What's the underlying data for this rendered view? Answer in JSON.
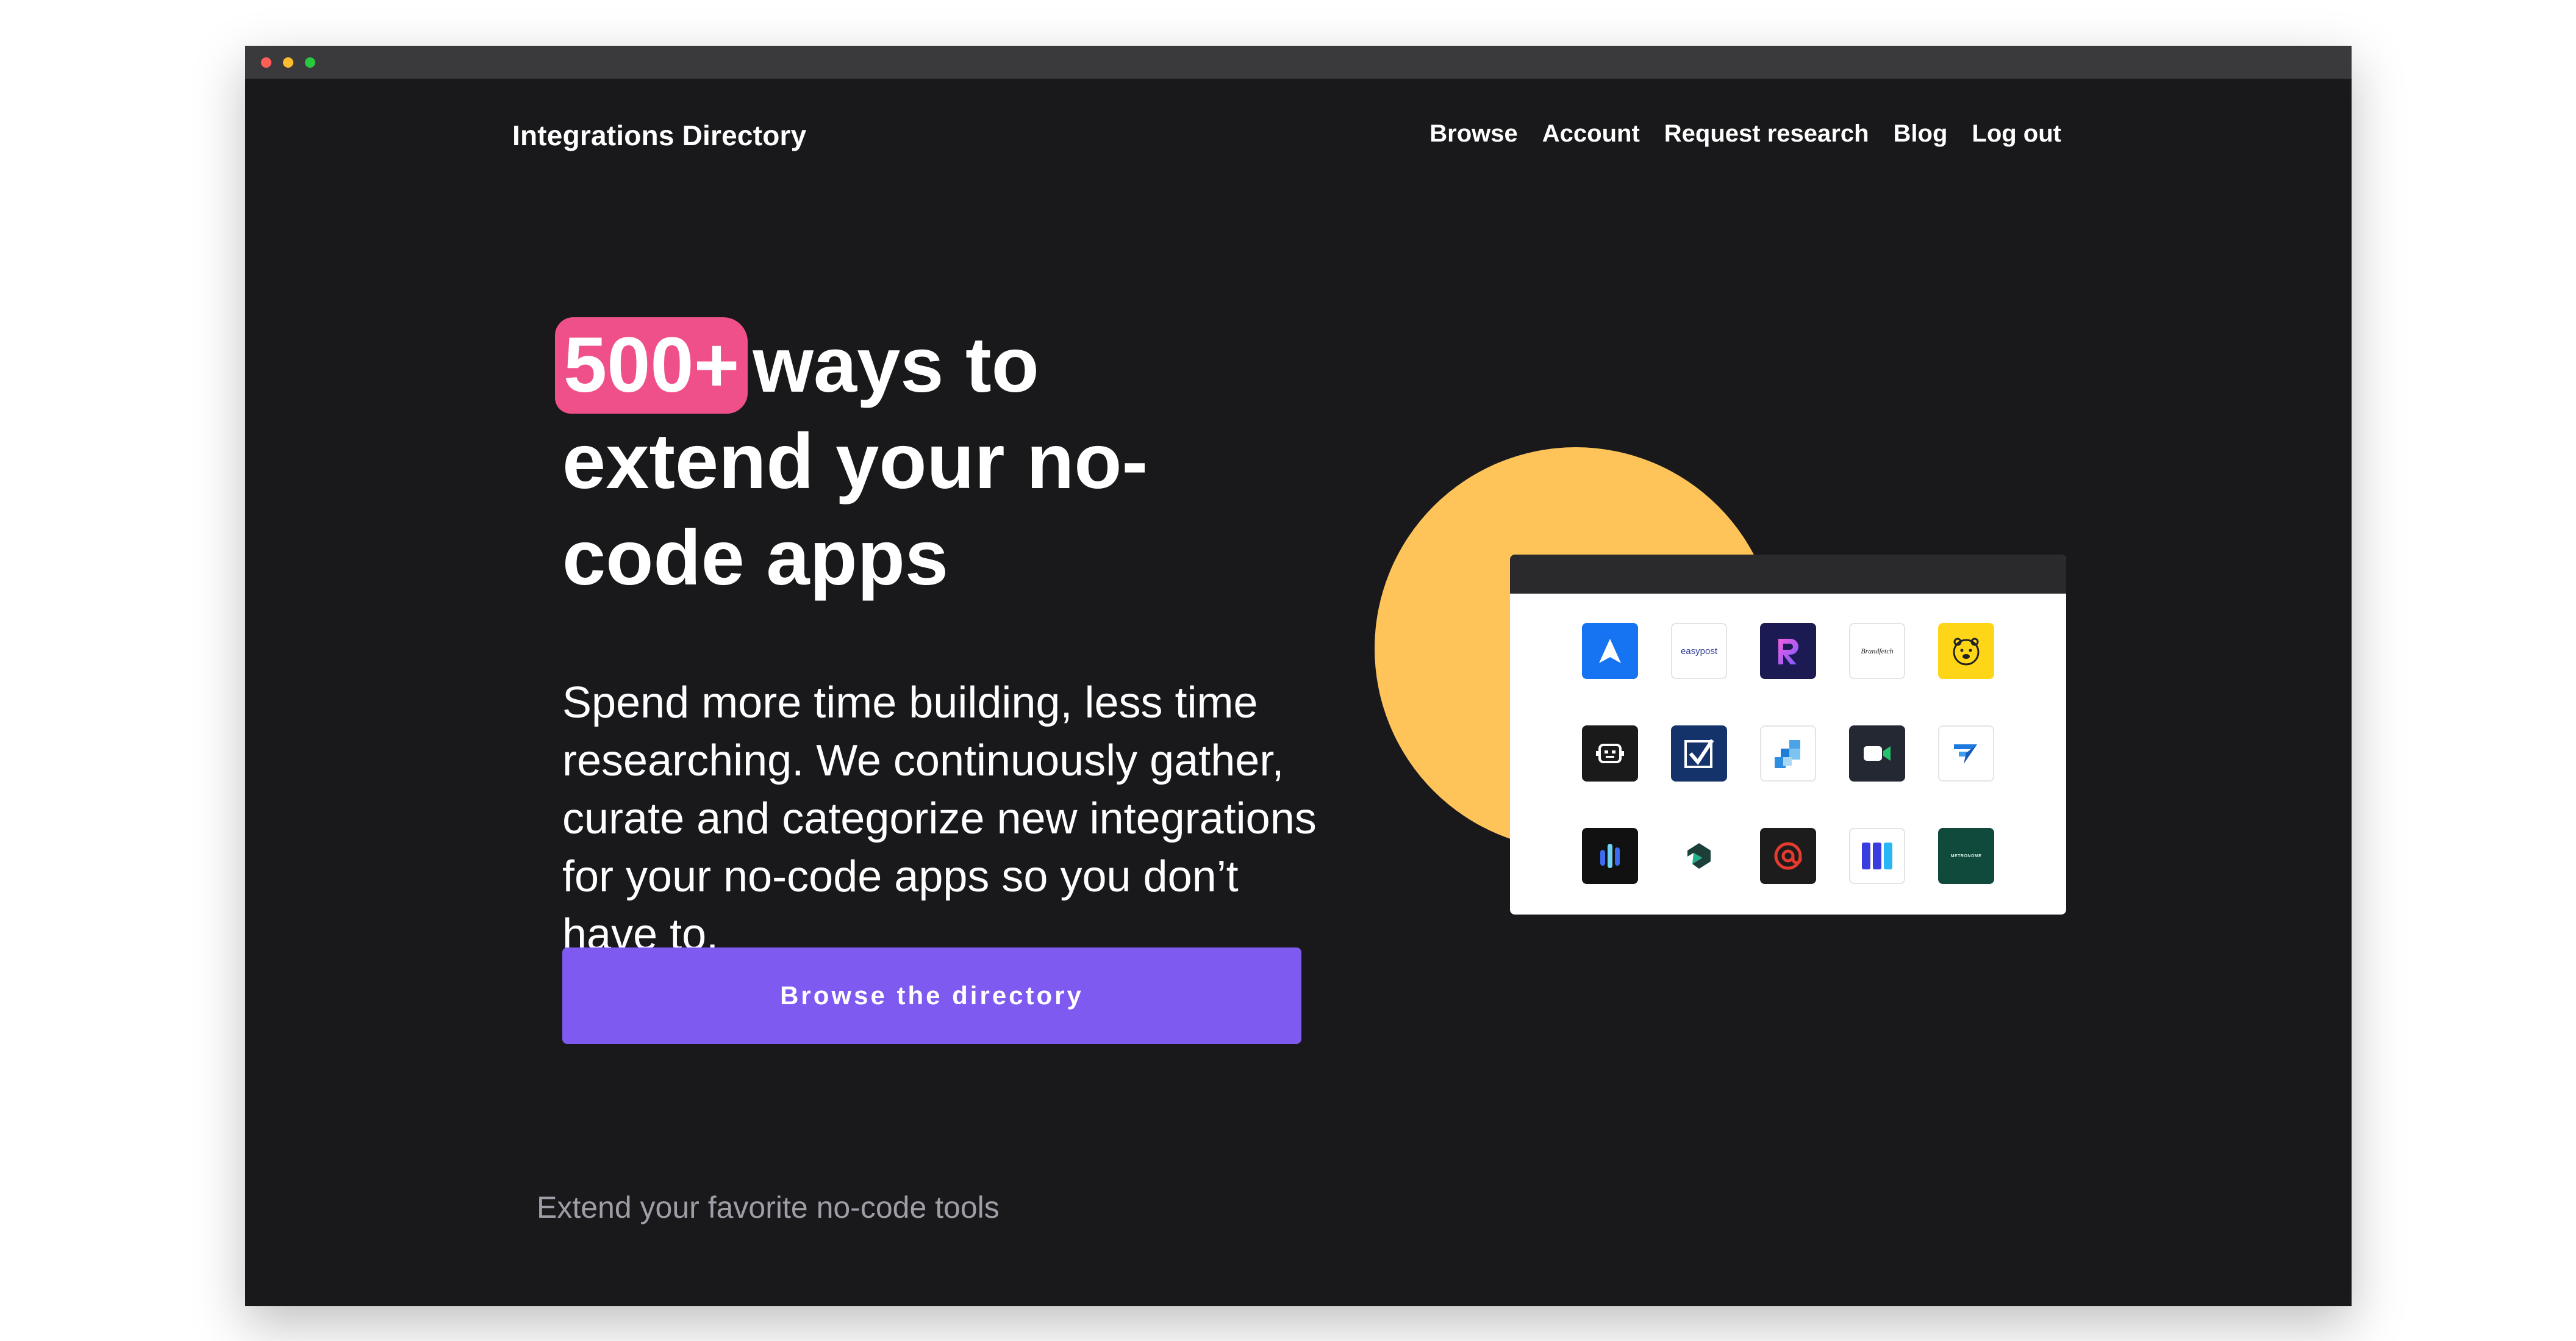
{
  "brand": "Integrations Directory",
  "nav": {
    "browse": "Browse",
    "account": "Account",
    "request_research": "Request research",
    "blog": "Blog",
    "logout": "Log out"
  },
  "hero": {
    "highlight": "500+",
    "title_line1_rest": "ways to",
    "title_line2": "extend your no-",
    "title_line3": "code apps",
    "subtitle": "Spend more time building, less time researching. We continuously gather, curate and categorize new integrations for your no-code apps so you don’t have to.",
    "cta_label": "Browse the directory"
  },
  "footer_note": "Extend your favorite no-code tools",
  "logo_tiles": {
    "easypost_text": "easypost",
    "brandfetch_text": "Brandfetch",
    "metronome_text": "METRONOME"
  },
  "colors": {
    "background": "#19191c",
    "highlight_pink": "#f0508a",
    "cta_purple": "#7f5af0",
    "circle_yellow": "#fec45a"
  }
}
